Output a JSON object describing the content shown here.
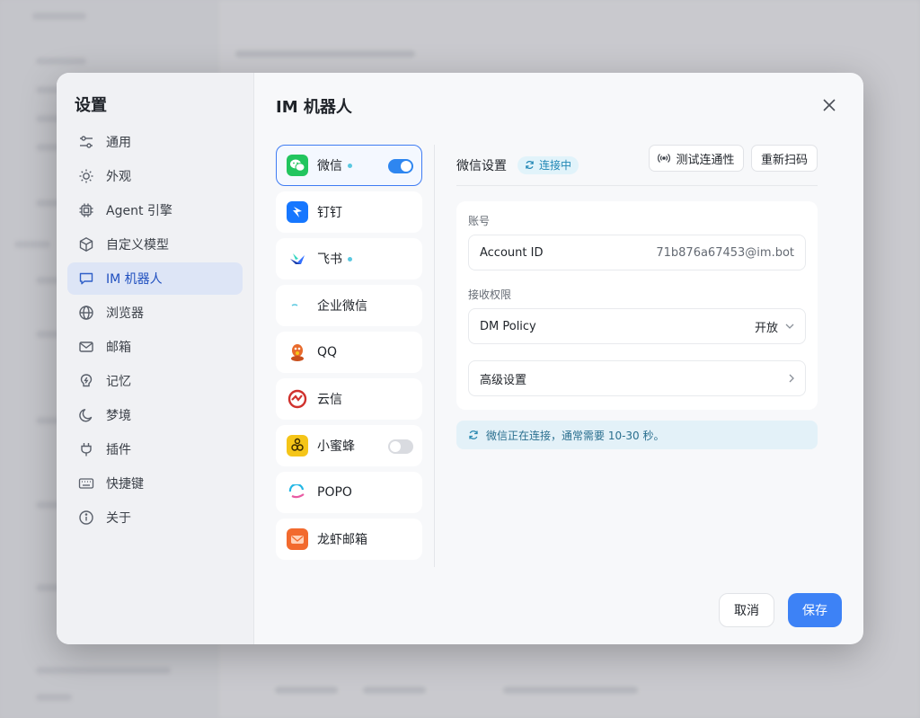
{
  "settings": {
    "title": "设置"
  },
  "nav": {
    "items": [
      {
        "label": "通用",
        "icon": "sliders-icon"
      },
      {
        "label": "外观",
        "icon": "sun-icon"
      },
      {
        "label": "Agent 引擎",
        "icon": "cpu-icon"
      },
      {
        "label": "自定义模型",
        "icon": "cube-icon"
      },
      {
        "label": "IM 机器人",
        "icon": "chat-bubble-icon"
      },
      {
        "label": "浏览器",
        "icon": "globe-icon"
      },
      {
        "label": "邮箱",
        "icon": "mail-icon"
      },
      {
        "label": "记忆",
        "icon": "lightning-bulb-icon"
      },
      {
        "label": "梦境",
        "icon": "moon-icon"
      },
      {
        "label": "插件",
        "icon": "plug-icon"
      },
      {
        "label": "快捷键",
        "icon": "keyboard-icon"
      },
      {
        "label": "关于",
        "icon": "info-icon"
      }
    ],
    "active_index": 4
  },
  "page": {
    "title": "IM 机器人"
  },
  "im_list": [
    {
      "name": "微信",
      "dot": true,
      "toggle": "on",
      "color": "#22c55e"
    },
    {
      "name": "钉钉",
      "dot": false,
      "toggle": null,
      "color": "#1677ff"
    },
    {
      "name": "飞书",
      "dot": true,
      "toggle": null,
      "color": "#3370ff"
    },
    {
      "name": "企业微信",
      "dot": false,
      "toggle": null,
      "color": "#5ac8e0"
    },
    {
      "name": "QQ",
      "dot": false,
      "toggle": null,
      "color": "#e86a2b"
    },
    {
      "name": "云信",
      "dot": false,
      "toggle": null,
      "color": "#d0312d"
    },
    {
      "name": "小蜜蜂",
      "dot": false,
      "toggle": "off",
      "color": "#f5c518"
    },
    {
      "name": "POPO",
      "dot": false,
      "toggle": null,
      "color": "#23b7e5"
    },
    {
      "name": "龙虾邮箱",
      "dot": false,
      "toggle": null,
      "color": "#f26a2e"
    }
  ],
  "detail": {
    "title": "微信设置",
    "status": "连接中",
    "test_button": "测试连通性",
    "rescan_button": "重新扫码",
    "account_section": "账号",
    "account_label": "Account ID",
    "account_value": "71b876a67453@im.bot",
    "permission_section": "接收权限",
    "dm_policy_label": "DM Policy",
    "dm_policy_value": "开放",
    "advanced_label": "高级设置",
    "notice": "微信正在连接，通常需要 10-30 秒。"
  },
  "footer": {
    "cancel": "取消",
    "save": "保存"
  },
  "colors": {
    "accent": "#3d82f6",
    "active_nav_bg": "#dde5f6",
    "notice_bg": "#e3f1f8"
  }
}
